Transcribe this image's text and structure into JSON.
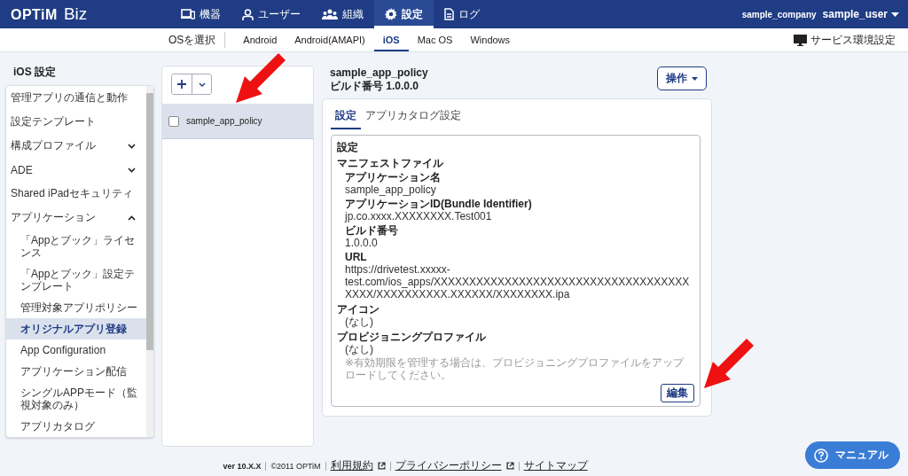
{
  "header": {
    "brand": "OPTiM",
    "product": "Biz",
    "nav": [
      {
        "label": "機器",
        "selected": false
      },
      {
        "label": "ユーザー",
        "selected": false
      },
      {
        "label": "組織",
        "selected": false
      },
      {
        "label": "設定",
        "selected": true
      },
      {
        "label": "ログ",
        "selected": false
      }
    ],
    "company": "sample_company",
    "user": "sample_user"
  },
  "subnav": {
    "label": "OSを選択",
    "tabs": [
      {
        "label": "Android",
        "selected": false
      },
      {
        "label": "Android(AMAPI)",
        "selected": false
      },
      {
        "label": "iOS",
        "selected": true
      },
      {
        "label": "Mac OS",
        "selected": false
      },
      {
        "label": "Windows",
        "selected": false
      }
    ],
    "service": "サービス環境設定"
  },
  "sidebar": {
    "title": "iOS 設定",
    "items": [
      {
        "label": "管理アプリの通信と動作",
        "selected": false
      },
      {
        "label": "設定テンプレート",
        "selected": false
      },
      {
        "label": "構成プロファイル",
        "selected": false,
        "expanded": false
      },
      {
        "label": "ADE",
        "selected": false,
        "expanded": false
      },
      {
        "label": "Shared iPadセキュリティ",
        "selected": false
      },
      {
        "label": "アプリケーション",
        "selected": false,
        "expanded": true,
        "children": [
          {
            "label": "「Appとブック」ライセンス",
            "selected": false
          },
          {
            "label": "「Appとブック」設定テンプレート",
            "selected": false
          },
          {
            "label": "管理対象アプリポリシー",
            "selected": false
          },
          {
            "label": "オリジナルアプリ登録",
            "selected": true
          },
          {
            "label": "App Configuration",
            "selected": false
          },
          {
            "label": "アプリケーション配信",
            "selected": false
          },
          {
            "label": "シングルAPPモード（監視対象のみ）",
            "selected": false
          },
          {
            "label": "アプリカタログ",
            "selected": false
          }
        ]
      }
    ]
  },
  "list": {
    "items": [
      {
        "label": "sample_app_policy",
        "checked": false,
        "selected": true
      }
    ]
  },
  "detail": {
    "title": "sample_app_policy",
    "build": "ビルド番号 1.0.0.0",
    "action": "操作",
    "tabs": [
      {
        "label": "設定",
        "selected": true
      },
      {
        "label": "アプリカタログ設定",
        "selected": false
      }
    ],
    "section": "設定",
    "fields": [
      {
        "label": "マニフェストファイル",
        "children": [
          {
            "label": "アプリケーション名",
            "value": "sample_app_policy"
          },
          {
            "label": "アプリケーションID(Bundle Identifier)",
            "value": "jp.co.xxxx.XXXXXXXX.Test001"
          },
          {
            "label": "ビルド番号",
            "value": "1.0.0.0"
          },
          {
            "label": "URL",
            "value": "https://drivetest.xxxxx-test.com/ios_apps/XXXXXXXXXXXXXXXXXXXXXXXXXXXXXXXXXXXXXXXX/XXXXXXXXXX.XXXXXX/XXXXXXXX.ipa"
          }
        ]
      },
      {
        "label": "アイコン",
        "value": "(なし)"
      },
      {
        "label": "プロビジョニングプロファイル",
        "value": "(なし)",
        "note": "※有効期限を管理する場合は、プロビジョニングプロファイルをアップロードしてください。"
      }
    ],
    "edit": "編集"
  },
  "footer": {
    "version": "ver 10.X.X",
    "copyright": "©2011 OPTiM",
    "links": [
      {
        "label": "利用規約",
        "external": true
      },
      {
        "label": "プライバシーポリシー",
        "external": true
      },
      {
        "label": "サイトマップ",
        "external": false
      }
    ]
  },
  "manual": "マニュアル"
}
